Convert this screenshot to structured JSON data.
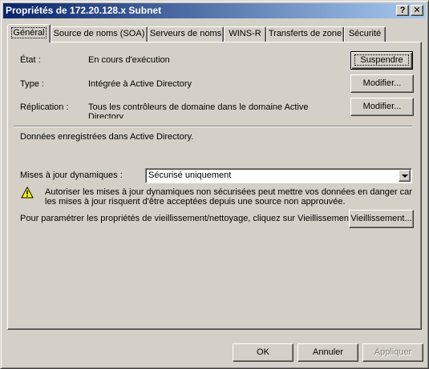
{
  "window": {
    "title": "Propriétés de 172.20.128.x Subnet",
    "help_label": "?",
    "close_label": "✕"
  },
  "tabs": [
    {
      "label": "Général",
      "active": true
    },
    {
      "label": "Source de noms (SOA)"
    },
    {
      "label": "Serveurs de noms"
    },
    {
      "label": "WINS-R"
    },
    {
      "label": "Transferts de zone"
    },
    {
      "label": "Sécurité"
    }
  ],
  "general": {
    "status_label": "État :",
    "status_value": "En cours d'exécution",
    "suspend_button": "Suspendre",
    "type_label": "Type :",
    "type_value": "Intégrée à Active Directory",
    "type_button": "Modifier...",
    "replication_label": "Réplication :",
    "replication_value": "Tous les contrôleurs de domaine dans le domaine Active Directory",
    "replication_button": "Modifier...",
    "storage_note": "Données enregistrées dans Active Directory.",
    "dynamic_updates_label": "Mises à jour dynamiques :",
    "dynamic_updates_value": "Sécurisé uniquement",
    "warning_text": "Autoriser les mises à jour dynamiques non sécurisées peut mettre vos données en danger car les mises à jour risquent d'être acceptées depuis une source non approuvée.",
    "aging_text": "Pour paramétrer les propriétés de vieillissement/nettoyage, cliquez sur Vieillissement.",
    "aging_button": "Vieillissement..."
  },
  "footer": {
    "ok": "OK",
    "cancel": "Annuler",
    "apply": "Appliquer"
  },
  "icons": {
    "warning": "warning-icon"
  },
  "colors": {
    "titlebar_start": "#0a246a",
    "titlebar_end": "#a6caf0",
    "dialog_face": "#d4d0c8",
    "warning_yellow": "#ffff00"
  }
}
